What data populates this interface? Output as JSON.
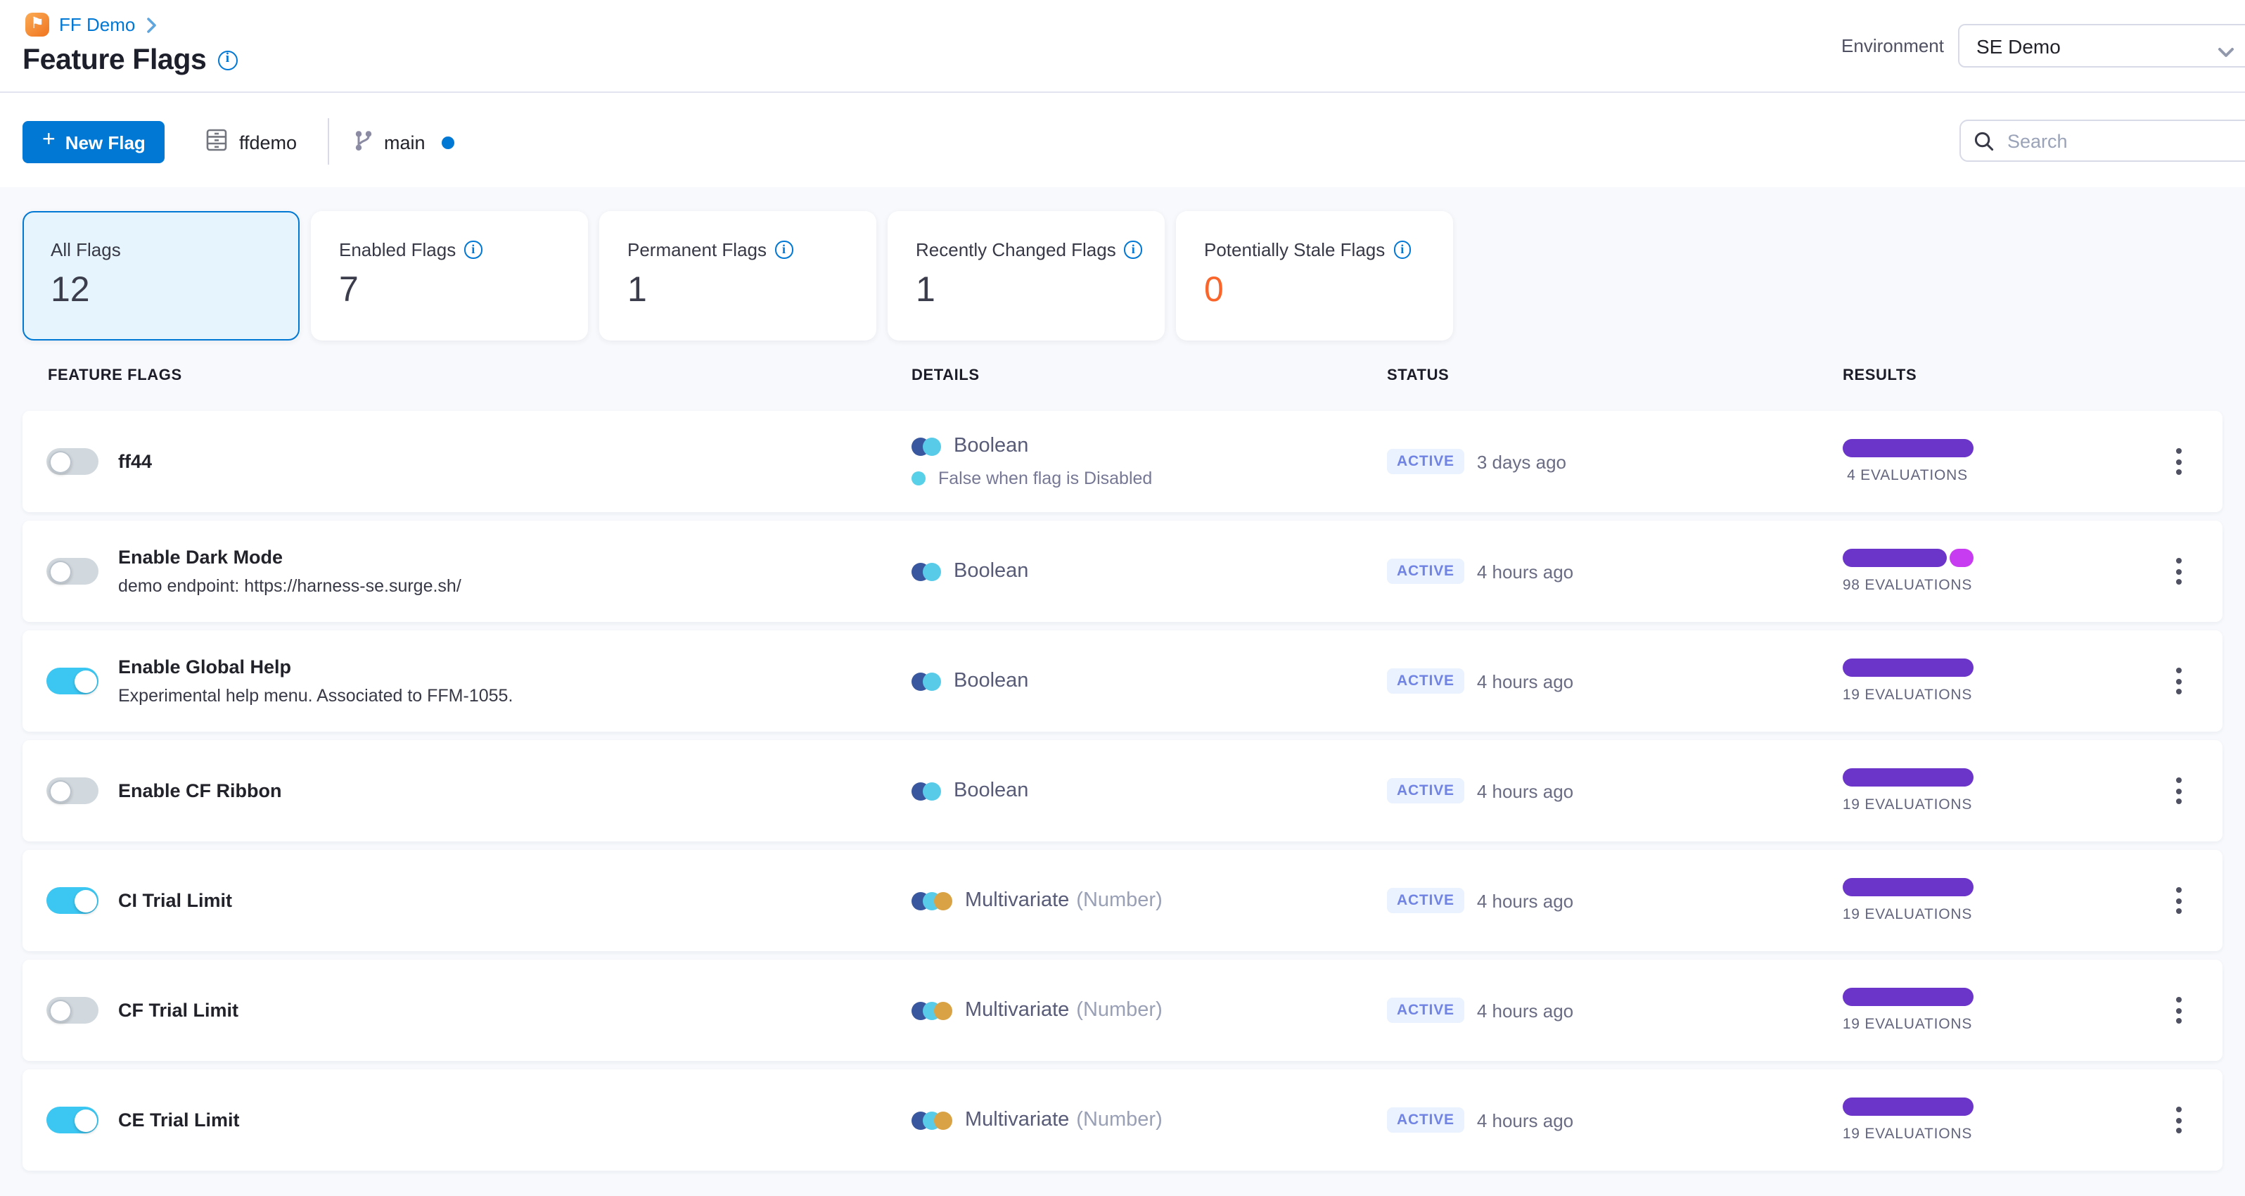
{
  "header": {
    "logo_icon": "harness-flag-logo",
    "breadcrumb_project": "FF Demo",
    "title": "Feature Flags",
    "environment_label": "Environment",
    "environment_value": "SE Demo"
  },
  "toolbar": {
    "new_flag_label": "New Flag",
    "repo_name": "ffdemo",
    "branch_name": "main",
    "search_placeholder": "Search"
  },
  "stat_cards": [
    {
      "label": "All Flags",
      "value": "12",
      "selected": true,
      "info": false
    },
    {
      "label": "Enabled Flags",
      "value": "7",
      "selected": false,
      "info": true
    },
    {
      "label": "Permanent Flags",
      "value": "1",
      "selected": false,
      "info": true
    },
    {
      "label": "Recently Changed Flags",
      "value": "1",
      "selected": false,
      "info": true
    },
    {
      "label": "Potentially Stale Flags",
      "value": "0",
      "selected": false,
      "info": true,
      "value_color": "#f9652a"
    }
  ],
  "table": {
    "columns": [
      "FEATURE FLAGS",
      "DETAILS",
      "STATUS",
      "RESULTS"
    ],
    "rows": [
      {
        "name": "ff44",
        "toggle": "off",
        "type": "Boolean",
        "type_icon": "boolean-icon",
        "default_note": "False when flag is Disabled",
        "status": "ACTIVE",
        "updated": "3 days ago",
        "evaluations_label": "4 EVALUATIONS",
        "bar_segments": [
          {
            "color": "#6b35c9",
            "width": 93
          }
        ]
      },
      {
        "name": "Enable Dark Mode",
        "description": "demo endpoint: https://harness-se.surge.sh/",
        "toggle": "off",
        "type": "Boolean",
        "type_icon": "boolean-icon",
        "status": "ACTIVE",
        "updated": "4 hours ago",
        "evaluations_label": "98 EVALUATIONS",
        "bar_segments": [
          {
            "color": "#6b35c9",
            "width": 74
          },
          {
            "color": "#c73cf0",
            "width": 17
          }
        ]
      },
      {
        "name": "Enable Global Help",
        "description": "Experimental help menu. Associated to FFM-1055.",
        "toggle": "on",
        "type": "Boolean",
        "type_icon": "boolean-icon",
        "status": "ACTIVE",
        "updated": "4 hours ago",
        "evaluations_label": "19 EVALUATIONS",
        "bar_segments": [
          {
            "color": "#6b35c9",
            "width": 93
          }
        ]
      },
      {
        "name": "Enable CF Ribbon",
        "toggle": "off",
        "type": "Boolean",
        "type_icon": "boolean-icon",
        "status": "ACTIVE",
        "updated": "4 hours ago",
        "evaluations_label": "19 EVALUATIONS",
        "bar_segments": [
          {
            "color": "#6b35c9",
            "width": 93
          }
        ]
      },
      {
        "name": "CI Trial Limit",
        "toggle": "on",
        "type": "Multivariate",
        "type_subtype": "(Number)",
        "type_icon": "multivariate-icon",
        "status": "ACTIVE",
        "updated": "4 hours ago",
        "evaluations_label": "19 EVALUATIONS",
        "bar_segments": [
          {
            "color": "#6b35c9",
            "width": 93
          }
        ]
      },
      {
        "name": "CF Trial Limit",
        "toggle": "off",
        "type": "Multivariate",
        "type_subtype": "(Number)",
        "type_icon": "multivariate-icon",
        "status": "ACTIVE",
        "updated": "4 hours ago",
        "evaluations_label": "19 EVALUATIONS",
        "bar_segments": [
          {
            "color": "#6b35c9",
            "width": 93
          }
        ]
      },
      {
        "name": "CE Trial Limit",
        "toggle": "on",
        "type": "Multivariate",
        "type_subtype": "(Number)",
        "type_icon": "multivariate-icon",
        "status": "ACTIVE",
        "updated": "4 hours ago",
        "evaluations_label": "19 EVALUATIONS",
        "bar_segments": [
          {
            "color": "#6b35c9",
            "width": 93
          }
        ]
      }
    ]
  },
  "colors": {
    "primary_blue": "#0278d5",
    "toggle_on_cyan": "#3cc7f3",
    "eval_purple": "#6b35c9",
    "eval_magenta": "#c73cf0",
    "stale_orange": "#f9652a",
    "active_badge_bg": "#e9f2fe",
    "active_badge_text": "#7184e4"
  }
}
